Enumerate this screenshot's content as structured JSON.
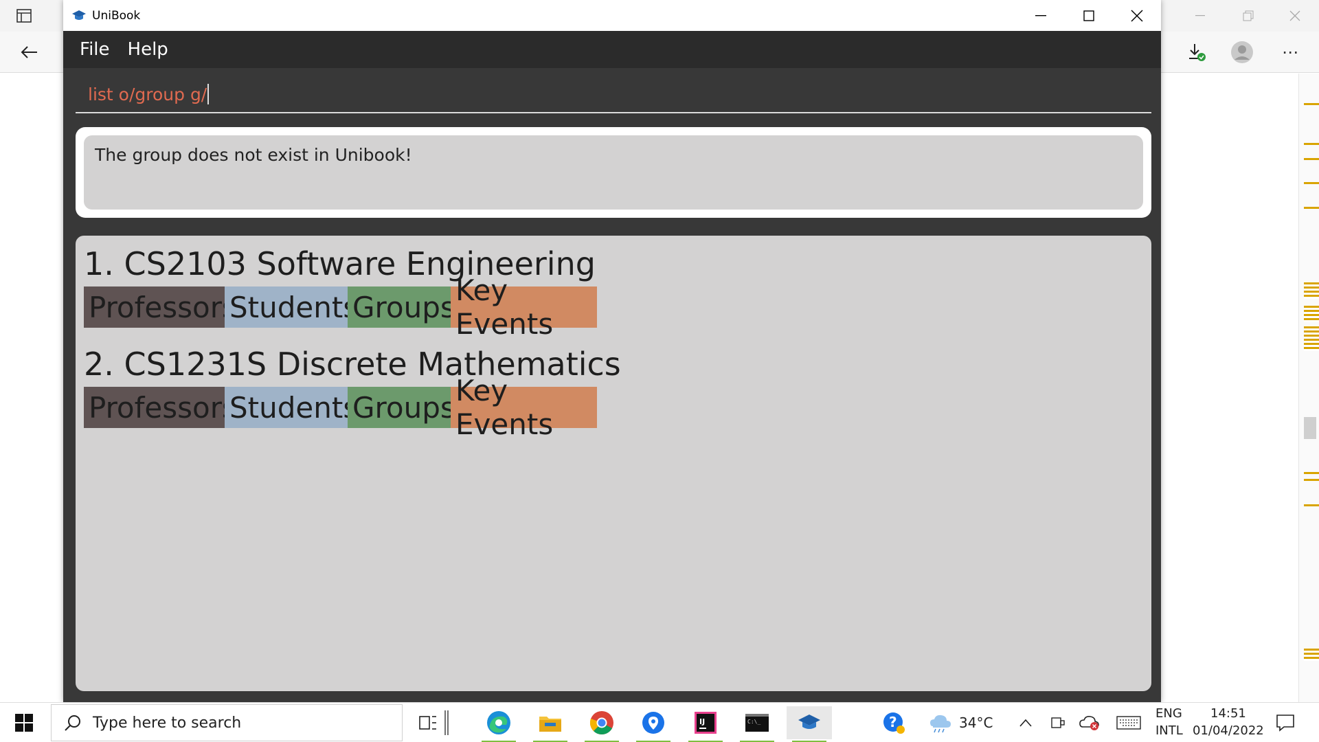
{
  "app": {
    "title": "UniBook",
    "menu": [
      "File",
      "Help"
    ],
    "command_input": "list o/group g/",
    "result_message": "The group  does not exist in Unibook!",
    "modules": [
      {
        "title": "1.  CS2103  Software Engineering",
        "tags": [
          "Professors",
          "Students",
          "Groups",
          "Key Events"
        ]
      },
      {
        "title": "2.  CS1231S  Discrete Mathematics",
        "tags": [
          "Professors",
          "Students",
          "Groups",
          "Key Events"
        ]
      }
    ],
    "tag_colors": {
      "professors": "#5f5353",
      "students": "#9fb3c8",
      "groups": "#6c9a6c",
      "key_events": "#d18a62"
    },
    "command_color": "#e06a50"
  },
  "taskbar": {
    "search_placeholder": "Type here to search",
    "weather": "34°C",
    "language_top": "ENG",
    "language_bottom": "INTL",
    "time": "14:51",
    "date": "01/04/2022"
  },
  "icons": [
    "start-icon",
    "search-icon",
    "task-view-icon",
    "edge-icon",
    "file-explorer-icon",
    "chrome-icon",
    "maps-icon",
    "intellij-icon",
    "terminal-icon",
    "unibook-icon"
  ]
}
